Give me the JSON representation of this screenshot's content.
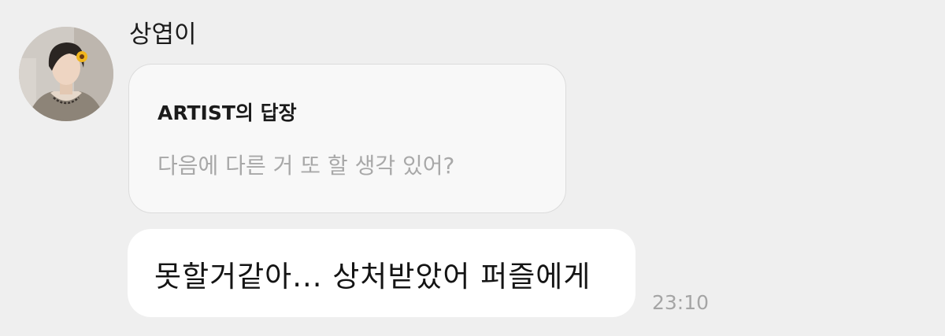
{
  "sender": {
    "name": "상엽이",
    "avatar": "profile-photo"
  },
  "reply": {
    "title": "ARTIST의 답장",
    "quoted_text": "다음에 다른 거 또 할 생각 있어?"
  },
  "message": {
    "text": "못할거같아... 상처받았어 퍼즐에게",
    "timestamp": "23:10"
  }
}
